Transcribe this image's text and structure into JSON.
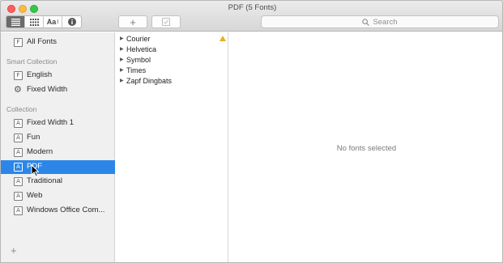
{
  "window": {
    "title": "PDF (5 Fonts)"
  },
  "toolbar": {
    "view_buttons": [
      "list-view-icon",
      "grid-view-icon",
      "sample-text-icon",
      "info-icon"
    ],
    "sample_text_label": "Aa",
    "add_label": "+",
    "search_placeholder": "Search"
  },
  "sidebar": {
    "all_fonts": "All Fonts",
    "smart_collection_header": "Smart Collection",
    "smart_collections": [
      {
        "label": "English",
        "icon": "F"
      },
      {
        "label": "Fixed Width",
        "icon": "gear"
      }
    ],
    "collection_header": "Collection",
    "collections": [
      {
        "label": "Fixed Width 1",
        "icon": "A"
      },
      {
        "label": "Fun",
        "icon": "A"
      },
      {
        "label": "Modern",
        "icon": "A"
      },
      {
        "label": "PDF",
        "icon": "A",
        "selected": true
      },
      {
        "label": "Traditional",
        "icon": "A"
      },
      {
        "label": "Web",
        "icon": "A"
      },
      {
        "label": "Windows Office Com...",
        "icon": "A"
      }
    ],
    "add_label": "+"
  },
  "font_list": {
    "families": [
      "Courier",
      "Helvetica",
      "Symbol",
      "Times",
      "Zapf Dingbats"
    ]
  },
  "preview": {
    "empty_message": "No fonts selected"
  }
}
